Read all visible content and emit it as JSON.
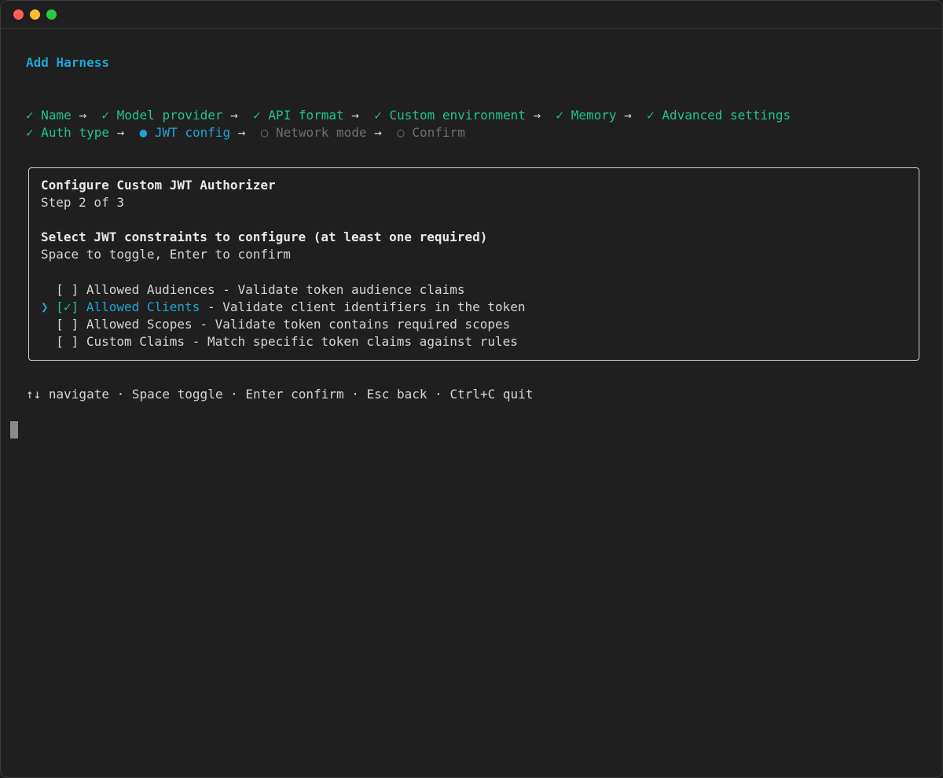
{
  "window": {
    "colors": {
      "background": "#1f1f1f",
      "accent": "#1fa4d2",
      "done": "#22c38a",
      "pending": "#6e6e6e"
    }
  },
  "header": {
    "title": "Add Harness"
  },
  "steps": {
    "row1": [
      {
        "icon": "✓",
        "label": "Name",
        "arrow": "→",
        "state": "done"
      },
      {
        "icon": "✓",
        "label": "Model provider",
        "arrow": "→",
        "state": "done"
      },
      {
        "icon": "✓",
        "label": "API format",
        "arrow": "→",
        "state": "done"
      },
      {
        "icon": "✓",
        "label": "Custom environment",
        "arrow": "→",
        "state": "done"
      },
      {
        "icon": "✓",
        "label": "Memory",
        "arrow": "→",
        "state": "done"
      },
      {
        "icon": "✓",
        "label": "Advanced settings",
        "arrow": "",
        "state": "done"
      }
    ],
    "row2": [
      {
        "icon": "✓",
        "label": "Auth type",
        "arrow": "→",
        "state": "done"
      },
      {
        "icon": "●",
        "label": "JWT config",
        "arrow": "→",
        "state": "current"
      },
      {
        "icon": "○",
        "label": "Network mode",
        "arrow": "→",
        "state": "pending"
      },
      {
        "icon": "○",
        "label": "Confirm",
        "arrow": "",
        "state": "pending"
      }
    ]
  },
  "panel": {
    "title": "Configure Custom JWT Authorizer",
    "step": "Step 2 of 3",
    "prompt": "Select JWT constraints to configure (at least one required)",
    "hint": "Space to toggle, Enter to confirm",
    "options": [
      {
        "pointer": " ",
        "checkbox": "[ ]",
        "label": "Allowed Audiences",
        "desc": " - Validate token audience claims",
        "selected": false,
        "focused": false
      },
      {
        "pointer": "❯",
        "checkbox": "[✓]",
        "label": "Allowed Clients",
        "desc": " - Validate client identifiers in the token",
        "selected": true,
        "focused": true
      },
      {
        "pointer": " ",
        "checkbox": "[ ]",
        "label": "Allowed Scopes",
        "desc": " - Validate token contains required scopes",
        "selected": false,
        "focused": false
      },
      {
        "pointer": " ",
        "checkbox": "[ ]",
        "label": "Custom Claims",
        "desc": " - Match specific token claims against rules",
        "selected": false,
        "focused": false
      }
    ]
  },
  "footer": {
    "keys": "↑↓ navigate · Space toggle · Enter confirm · Esc back · Ctrl+C quit"
  }
}
